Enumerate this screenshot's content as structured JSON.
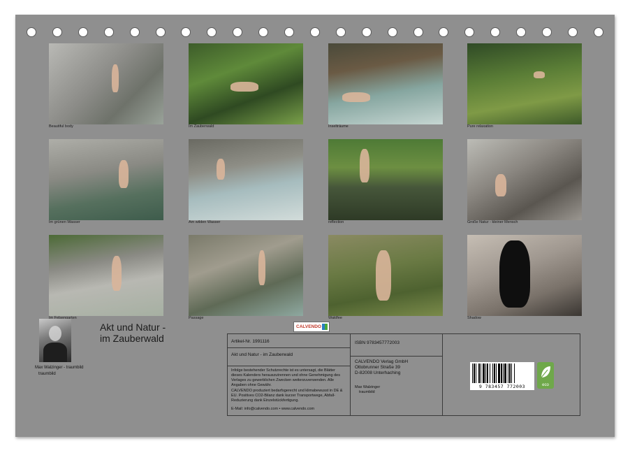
{
  "photos": [
    {
      "caption": "Beautiful body",
      "gradient": "linear-gradient(135deg,#b9b9b5 0%,#8c8c88 45%,#6e726a 70%,#9aa39a 100%)"
    },
    {
      "caption": "Im Zauberwald",
      "gradient": "linear-gradient(160deg,#3d5c2a 0%,#5f8a3a 35%,#2f4a22 65%,#7aa04a 100%)"
    },
    {
      "caption": "Inselträume",
      "gradient": "linear-gradient(170deg,#4a4a3a 0%,#6a5a44 30%,#86a6a0 60%,#c6d6d2 100%)"
    },
    {
      "caption": "Pure relaxation",
      "gradient": "linear-gradient(170deg,#2f4a26 0%,#5a7d36 40%,#7f9a46 70%,#3e5a2a 100%)"
    },
    {
      "caption": "Im grünen Wasser",
      "gradient": "linear-gradient(170deg,#aeaea8 0%,#8a8a84 40%,#56705e 70%,#3e5c4c 100%)"
    },
    {
      "caption": "Am wilden Wasser",
      "gradient": "linear-gradient(170deg,#6a6a62 0%,#8e8e86 35%,#a6bcbe 60%,#d2dcda 100%)"
    },
    {
      "caption": "reflection",
      "gradient": "linear-gradient(180deg,#4e7a36 0%,#6d8f42 35%,#46563a 60%,#2e3a26 100%)"
    },
    {
      "caption": "Große Natur - kleiner Mensch",
      "gradient": "linear-gradient(150deg,#bcbcb6 0%,#8a8680 40%,#5a5650 70%,#9a9690 100%)"
    },
    {
      "caption": "Im Felsengarten",
      "gradient": "linear-gradient(170deg,#4c6a36 0%,#8a8a84 35%,#b8b8b2 60%,#a6b0a2 100%)"
    },
    {
      "caption": "Passage",
      "gradient": "linear-gradient(160deg,#7a7a6a 0%,#a09c8e 35%,#5f6a56 65%,#8ea8a0 100%)"
    },
    {
      "caption": "Waldfee",
      "gradient": "linear-gradient(170deg,#8a8a62 0%,#6a7a44 40%,#4e6230 70%,#7a8a4a 100%)"
    },
    {
      "caption": "Shadow",
      "gradient": "linear-gradient(160deg,#c6beb4 0%,#a09890 40%,#7a726a 70%,#3a3632 100%)"
    }
  ],
  "photographer": {
    "name": "Max Walzinger - traumbild",
    "label": "traumbild"
  },
  "title": {
    "line1": "Akt und Natur -",
    "line2": "im Zauberwald"
  },
  "info": {
    "article": "Artikel-Nr. 1991116",
    "logo": "CALVENDO",
    "product_title": "Akt und Natur - im Zauberwald",
    "rights_text": "Infolge bestehender Schutzrechte ist es untersagt, die Blätter dieses Kalenders herauszutrennen und ohne Genehmigung des Verlages zu gewerblichen Zwecken weiterzuverwenden. Alle Angaben ohne Gewähr.",
    "eco_text": "CALVENDO produziert bedarfsgerecht und klimabewusst in DE & EU. Positives CO2-Bilanz dank kurzer Transportwege, Abfall-Reduzierung dank Einzelstückfertigung.",
    "contact": "E-Mail: info@calvendo.com • www.calvendo.com",
    "isbn": "ISBN 9783457772003",
    "publisher_name": "CALVENDO Verlag GmbH",
    "publisher_street": "Ottobrunner Straße 39",
    "publisher_city": "D-82008 Unterhaching",
    "author_name": "Max Walzinger",
    "author_label": "traumbild",
    "barcode_digits": "9 783457 772003",
    "eco_badge": "eco"
  }
}
